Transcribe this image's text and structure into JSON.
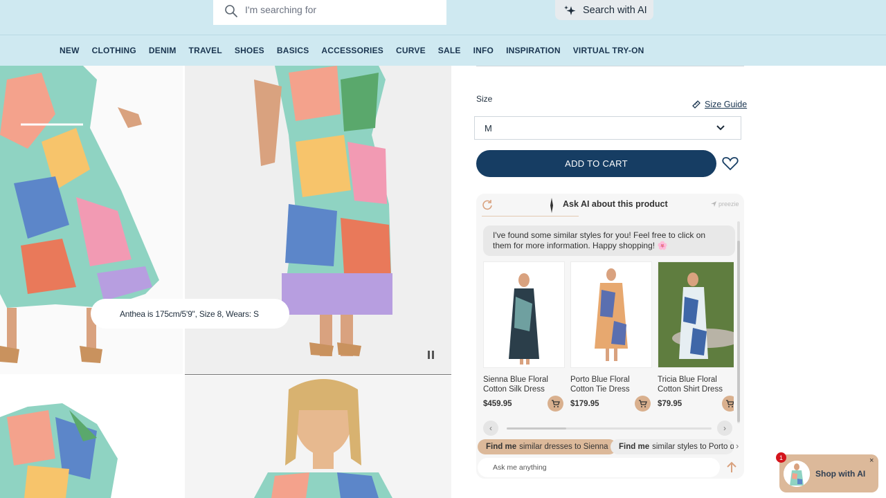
{
  "search": {
    "placeholder": "I'm searching for",
    "ai_button_label": "Search with AI"
  },
  "nav": {
    "items": [
      "NEW",
      "CLOTHING",
      "DENIM",
      "TRAVEL",
      "SHOES",
      "BASICS",
      "ACCESSORIES",
      "CURVE",
      "SALE",
      "INFO",
      "INSPIRATION",
      "VIRTUAL TRY-ON"
    ]
  },
  "gallery": {
    "model_caption": "Anthea is 175cm/5'9\", Size 8, Wears: S"
  },
  "product": {
    "size_label": "Size",
    "size_guide_label": "Size Guide",
    "size_selected": "M",
    "add_to_cart_label": "ADD TO CART"
  },
  "ai_assistant": {
    "title": "Ask AI about this product",
    "brand": "preezie",
    "message": "I've found some similar styles for you! Feel free to click on them for more information. Happy shopping! 🌸",
    "products": [
      {
        "name": "Sienna Blue Floral Cotton Silk Dress",
        "price": "$459.95"
      },
      {
        "name": "Porto Blue Floral Cotton Tie Dress",
        "price": "$179.95"
      },
      {
        "name": "Tricia Blue Floral Cotton Shirt Dress",
        "price": "$79.95"
      }
    ],
    "chips": [
      {
        "bold": "Find me",
        "rest": "similar dresses to Sienna"
      },
      {
        "bold": "Find me",
        "rest": "similar styles to Porto dr"
      }
    ],
    "input_placeholder": "Ask me anything"
  },
  "shop_widget": {
    "label": "Shop with AI",
    "badge_count": "1",
    "close": "×"
  },
  "colors": {
    "header_bg": "#cfe9f1",
    "navy": "#163d63",
    "accent_tan": "#dcb99a"
  }
}
